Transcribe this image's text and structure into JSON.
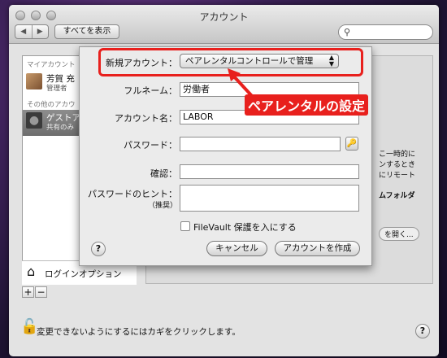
{
  "window": {
    "title": "アカウント"
  },
  "toolbar": {
    "back": "◀",
    "forward": "▶",
    "show_all": "すべてを表示",
    "search_placeholder": ""
  },
  "sidebar": {
    "my_account_header": "マイアカウント",
    "my_user": {
      "name": "芳賀 充",
      "role": "管理者"
    },
    "other_header": "その他のアカウ",
    "guest": {
      "name": "ゲストア",
      "role": "共有のみ"
    },
    "login_options": "ログインオプション",
    "add": "+",
    "remove": "−"
  },
  "background_fragments": {
    "right1": "こ一時的に",
    "right2": "ンするとき",
    "right3": "にリモート",
    "right4": "ムフォルダ",
    "open_button": "を開く..."
  },
  "sheet": {
    "new_account_label": "新規アカウント：",
    "new_account_value": "ペアレンタルコントロールで管理",
    "fullname_label": "フルネーム：",
    "fullname_value": "労働者",
    "account_name_label": "アカウント名：",
    "account_name_value": "LABOR",
    "password_label": "パスワード：",
    "password_value": "",
    "verify_label": "確認：",
    "verify_value": "",
    "hint_label": "パスワードのヒント：",
    "hint_sub": "（推奨）",
    "hint_value": "",
    "filevault_label": "FileVault 保護を入にする",
    "filevault_checked": false,
    "help": "?",
    "cancel": "キャンセル",
    "create": "アカウントを作成"
  },
  "bottom": {
    "lock_text": "変更できないようにするにはカギをクリックします。",
    "help": "?"
  },
  "annotation": {
    "callout_text": "ペアレンタルの設定",
    "color": "#e8201d"
  }
}
